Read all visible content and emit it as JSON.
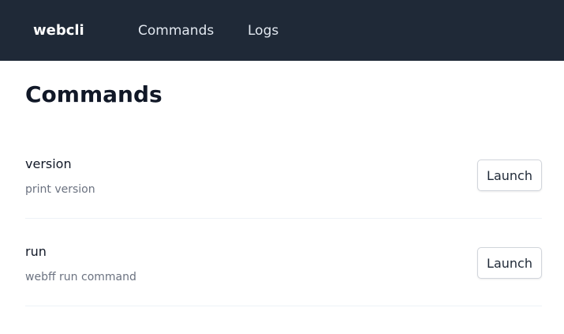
{
  "navbar": {
    "brand": "webcli",
    "links": [
      {
        "label": "Commands"
      },
      {
        "label": "Logs"
      }
    ]
  },
  "main": {
    "title": "Commands",
    "commands": [
      {
        "name": "version",
        "description": "print version",
        "button_label": "Launch"
      },
      {
        "name": "run",
        "description": "webff run command",
        "button_label": "Launch"
      }
    ]
  },
  "colors": {
    "navbar_bg": "#1f2937",
    "text": "#111827",
    "muted": "#6b7280",
    "divider": "#edf2f7"
  }
}
